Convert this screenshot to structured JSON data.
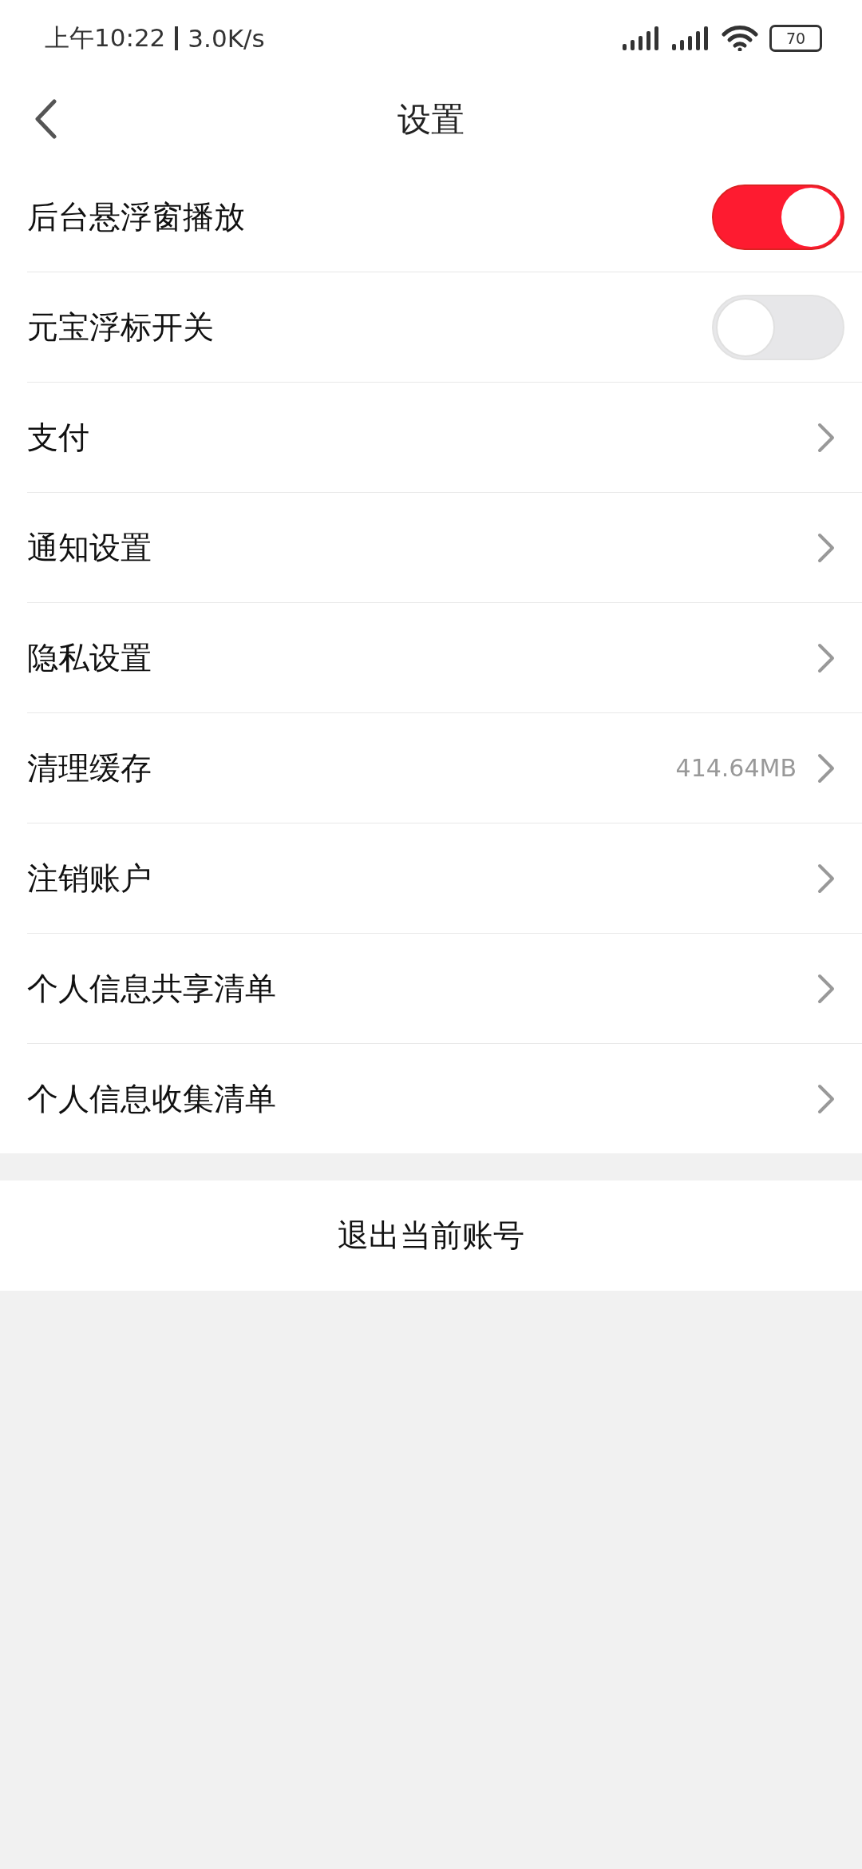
{
  "status_bar": {
    "time": "上午10:22",
    "speed": "3.0K/s",
    "battery": "70"
  },
  "header": {
    "title": "设置"
  },
  "rows": [
    {
      "kind": "toggle",
      "label": "后台悬浮窗播放",
      "on": true
    },
    {
      "kind": "toggle",
      "label": "元宝浮标开关",
      "on": false
    },
    {
      "kind": "link",
      "label": "支付"
    },
    {
      "kind": "link",
      "label": "通知设置"
    },
    {
      "kind": "link",
      "label": "隐私设置"
    },
    {
      "kind": "link",
      "label": "清理缓存",
      "value": "414.64MB"
    },
    {
      "kind": "link",
      "label": "注销账户"
    },
    {
      "kind": "link",
      "label": "个人信息共享清单"
    },
    {
      "kind": "link",
      "label": "个人信息收集清单"
    }
  ],
  "logout_button": "退出当前账号"
}
